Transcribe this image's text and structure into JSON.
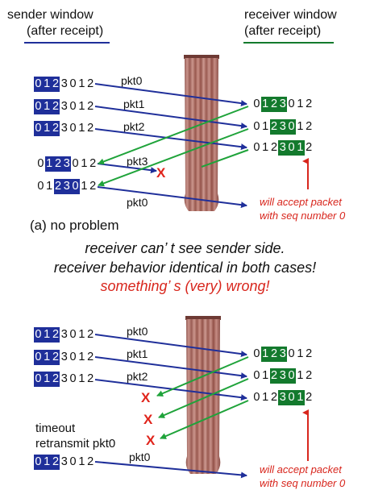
{
  "headers": {
    "sender_title": "sender window",
    "sender_sub": "(after receipt)",
    "receiver_title": "receiver window",
    "receiver_sub": "(after receipt)"
  },
  "colors": {
    "sender_highlight": "#1f2f9a",
    "receiver_highlight": "#137a2d",
    "arrow_blue": "#1f2f9a",
    "arrow_green": "#1fa33a",
    "red": "#d8261d",
    "curtain": "#b3736a"
  },
  "scenario_a": {
    "caption": "(a) no problem",
    "sender_rows": [
      {
        "digits": [
          "0",
          "1",
          "2",
          "3",
          "0",
          "1",
          "2"
        ],
        "highlight": [
          0,
          1,
          2
        ]
      },
      {
        "digits": [
          "0",
          "1",
          "2",
          "3",
          "0",
          "1",
          "2"
        ],
        "highlight": [
          0,
          1,
          2
        ]
      },
      {
        "digits": [
          "0",
          "1",
          "2",
          "3",
          "0",
          "1",
          "2"
        ],
        "highlight": [
          0,
          1,
          2
        ]
      },
      {
        "digits": [
          "0",
          "1",
          "2",
          "3",
          "0",
          "1",
          "2"
        ],
        "highlight": [
          1,
          2,
          3
        ]
      },
      {
        "digits": [
          "0",
          "1",
          "2",
          "3",
          "0",
          "1",
          "2"
        ],
        "highlight": [
          2,
          3,
          4
        ]
      }
    ],
    "receiver_rows": [
      {
        "digits": [
          "0",
          "1",
          "2",
          "3",
          "0",
          "1",
          "2"
        ],
        "highlight": [
          1,
          2,
          3
        ]
      },
      {
        "digits": [
          "0",
          "1",
          "2",
          "3",
          "0",
          "1",
          "2"
        ],
        "highlight": [
          2,
          3,
          4
        ]
      },
      {
        "digits": [
          "0",
          "1",
          "2",
          "3",
          "0",
          "1",
          "2"
        ],
        "highlight": [
          3,
          4,
          5
        ]
      }
    ],
    "packet_labels": [
      "pkt0",
      "pkt1",
      "pkt2",
      "pkt3",
      "pkt0"
    ],
    "lost_marker": "X",
    "accept_note_line1": "will accept packet",
    "accept_note_line2": "with seq number 0"
  },
  "middle_text": {
    "line1": "receiver can’ t see sender side.",
    "line2": "receiver behavior identical in both cases!",
    "line3": "something’ s (very) wrong!"
  },
  "scenario_b": {
    "sender_rows": [
      {
        "digits": [
          "0",
          "1",
          "2",
          "3",
          "0",
          "1",
          "2"
        ],
        "highlight": [
          0,
          1,
          2
        ]
      },
      {
        "digits": [
          "0",
          "1",
          "2",
          "3",
          "0",
          "1",
          "2"
        ],
        "highlight": [
          0,
          1,
          2
        ]
      },
      {
        "digits": [
          "0",
          "1",
          "2",
          "3",
          "0",
          "1",
          "2"
        ],
        "highlight": [
          0,
          1,
          2
        ]
      },
      {
        "digits": [
          "0",
          "1",
          "2",
          "3",
          "0",
          "1",
          "2"
        ],
        "highlight": [
          0,
          1,
          2
        ]
      }
    ],
    "receiver_rows": [
      {
        "digits": [
          "0",
          "1",
          "2",
          "3",
          "0",
          "1",
          "2"
        ],
        "highlight": [
          1,
          2,
          3
        ]
      },
      {
        "digits": [
          "0",
          "1",
          "2",
          "3",
          "0",
          "1",
          "2"
        ],
        "highlight": [
          2,
          3,
          4
        ]
      },
      {
        "digits": [
          "0",
          "1",
          "2",
          "3",
          "0",
          "1",
          "2"
        ],
        "highlight": [
          3,
          4,
          5
        ]
      }
    ],
    "packet_labels": [
      "pkt0",
      "pkt1",
      "pkt2",
      "pkt0"
    ],
    "lost_markers": [
      "X",
      "X",
      "X"
    ],
    "timeout_line1": "timeout",
    "timeout_line2": "retransmit pkt0",
    "accept_note_line1": "will accept packet",
    "accept_note_line2": "with seq number 0"
  }
}
